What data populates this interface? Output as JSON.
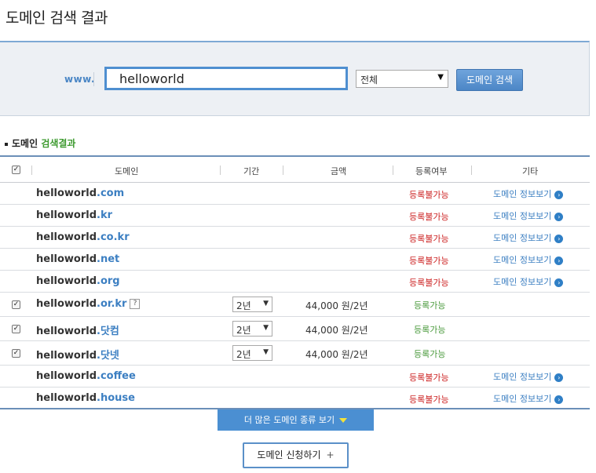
{
  "page": {
    "title": "도메인 검색 결과"
  },
  "search": {
    "prefix": "www.",
    "value": "helloworld",
    "scope": "전체",
    "scope_arrow": "▼",
    "button": "도메인 검색"
  },
  "section": {
    "label_a": "도메인",
    "label_b": "검색결과"
  },
  "columns": {
    "domain": "도메인",
    "period": "기간",
    "price": "금액",
    "status": "등록여부",
    "etc": "기타"
  },
  "rows": [
    {
      "base": "helloworld",
      "tld": ".com",
      "status": "등록불가능",
      "info": "도메인 정보보기"
    },
    {
      "base": "helloworld",
      "tld": ".kr",
      "status": "등록불가능",
      "info": "도메인 정보보기"
    },
    {
      "base": "helloworld",
      "tld": ".co.kr",
      "status": "등록불가능",
      "info": "도메인 정보보기"
    },
    {
      "base": "helloworld",
      "tld": ".net",
      "status": "등록불가능",
      "info": "도메인 정보보기"
    },
    {
      "base": "helloworld",
      "tld": ".org",
      "status": "등록불가능",
      "info": "도메인 정보보기"
    },
    {
      "base": "helloworld",
      "tld": ".or.kr",
      "help": "?",
      "period": "2년",
      "price": "44,000 원/2년",
      "status": "등록가능",
      "checked": true
    },
    {
      "base": "helloworld",
      "tld": ".닷컴",
      "period": "2년",
      "price": "44,000 원/2년",
      "status": "등록가능",
      "checked": true
    },
    {
      "base": "helloworld",
      "tld": ".닷넷",
      "period": "2년",
      "price": "44,000 원/2년",
      "status": "등록가능",
      "checked": true
    },
    {
      "base": "helloworld",
      "tld": ".coffee",
      "status": "등록불가능",
      "info": "도메인 정보보기"
    },
    {
      "base": "helloworld",
      "tld": ".house",
      "status": "등록불가능",
      "info": "도메인 정보보기"
    }
  ],
  "icons": {
    "info": "arrow-circle-icon",
    "checkbox": "check-icon"
  },
  "colors": {
    "accent": "#4b8fd2",
    "unavailable": "#cc2222",
    "available": "#4a9a3c",
    "link": "#3c7fc2"
  },
  "more_button": "더 많은 도메인 종류 보기",
  "apply_button": {
    "label": "도메인 신청하기",
    "plus": "+"
  }
}
